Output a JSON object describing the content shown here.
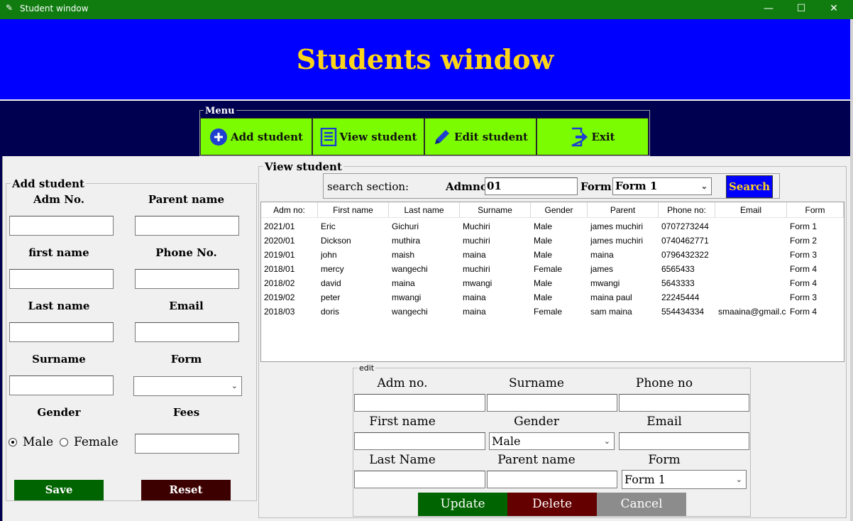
{
  "window": {
    "title": "Student window",
    "icon": "feather-icon",
    "minimize": "—",
    "maximize": "☐",
    "close": "✕"
  },
  "header": {
    "title": "Students window"
  },
  "colors": {
    "titlebar": "#107c10",
    "header": "#0000ff",
    "title_text": "#ffd51a",
    "nav_band": "#000050",
    "menu_button": "#7cfc00",
    "save": "#006400",
    "reset": "#3c0000",
    "update": "#006400",
    "delete": "#640000",
    "cancel": "#8c8c8c",
    "search_button": "#0000ff",
    "search_text": "#ffd51a"
  },
  "menu": {
    "legend": "Menu",
    "items": [
      {
        "label": "Add student",
        "icon": "add-circle-icon"
      },
      {
        "label": "View student",
        "icon": "list-document-icon"
      },
      {
        "label": "Edit student",
        "icon": "pencil-icon"
      },
      {
        "label": "Exit",
        "icon": "exit-icon"
      }
    ]
  },
  "add_student": {
    "legend": "Add student",
    "adm_no_label": "Adm No.",
    "parent_name_label": "Parent name",
    "first_name_label": "first name",
    "phone_label": "Phone No.",
    "last_name_label": "Last name",
    "email_label": "Email",
    "surname_label": "Surname",
    "form_label": "Form",
    "form_value": "",
    "gender_label": "Gender",
    "fees_label": "Fees",
    "gender_options": [
      "Male",
      "Female"
    ],
    "gender_selected": "Male",
    "save_label": "Save",
    "reset_label": "Reset"
  },
  "view_student": {
    "legend": "View student",
    "search": {
      "section_label": "search section:",
      "admno_label": "Admno",
      "admno_value": "01",
      "form_label": "Form",
      "form_value": "Form 1",
      "button_label": "Search"
    },
    "columns": [
      "Adm no:",
      "First name",
      "Last name",
      "Surname",
      "Gender",
      "Parent",
      "Phone no:",
      "Email",
      "Form"
    ],
    "rows": [
      [
        "2021/01",
        "Eric",
        "Gichuri",
        "Muchiri",
        "Male",
        "james muchiri",
        "0707273244",
        "",
        "Form 1"
      ],
      [
        "2020/01",
        "Dickson",
        "muthira",
        "muchiri",
        "Male",
        "james muchiri",
        "0740462771",
        "",
        "Form 2"
      ],
      [
        "2019/01",
        "john",
        "maish",
        "maina",
        "Male",
        "maina",
        "0796432322",
        "",
        "Form 3"
      ],
      [
        "2018/01",
        "mercy",
        "wangechi",
        "muchiri",
        "Female",
        "james",
        "6565433",
        "",
        "Form 4"
      ],
      [
        "2018/02",
        "david",
        "maina",
        "mwangi",
        "Male",
        "mwangi",
        "5643333",
        "",
        "Form 4"
      ],
      [
        "2019/02",
        "peter",
        "mwangi",
        "maina",
        "Male",
        "maina paul",
        "22245444",
        "",
        "Form 3"
      ],
      [
        "2018/03",
        "doris",
        "wangechi",
        "maina",
        "Female",
        "sam maina",
        "554434334",
        "smaaina@gmail.c",
        "Form 4"
      ]
    ]
  },
  "edit": {
    "legend": "edit",
    "adm_no_label": "Adm no.",
    "surname_label": "Surname",
    "phone_label": "Phone no",
    "first_name_label": "First name",
    "gender_label": "Gender",
    "gender_value": "Male",
    "email_label": "Email",
    "last_name_label": "Last Name",
    "parent_name_label": "Parent name",
    "form_label": "Form",
    "form_value": "Form 1",
    "update_label": "Update",
    "delete_label": "Delete",
    "cancel_label": "Cancel"
  }
}
